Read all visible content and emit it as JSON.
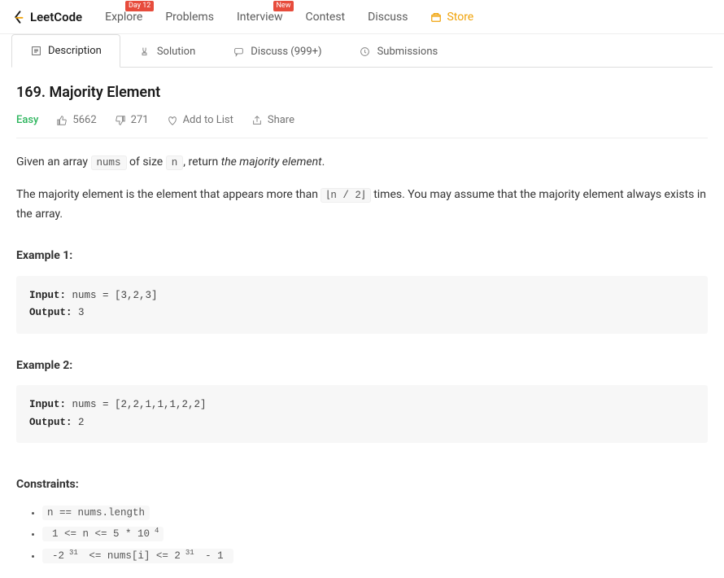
{
  "nav": {
    "logo_text": "LeetCode",
    "items": [
      {
        "label": "Explore",
        "badge": "Day 12"
      },
      {
        "label": "Problems",
        "badge": null
      },
      {
        "label": "Interview",
        "badge": "New"
      },
      {
        "label": "Contest",
        "badge": null
      },
      {
        "label": "Discuss",
        "badge": null
      },
      {
        "label": "Store",
        "badge": null,
        "store": true
      }
    ]
  },
  "tabs": {
    "description": "Description",
    "solution": "Solution",
    "discuss": "Discuss (999+)",
    "submissions": "Submissions"
  },
  "problem": {
    "title": "169. Majority Element",
    "difficulty": "Easy",
    "likes": "5662",
    "dislikes": "271",
    "add_to_list": "Add to List",
    "share": "Share",
    "para1_a": "Given an array ",
    "code_nums": "nums",
    "para1_b": " of size ",
    "code_n": "n",
    "para1_c": ", return ",
    "para1_d": "the majority element",
    "para1_e": ".",
    "para2_a": "The majority element is the element that appears more than ",
    "code_floor": "⌊n / 2⌋",
    "para2_b": " times. You may assume that the majority element always exists in the array.",
    "example1_head": "Example 1:",
    "example1_input_label": "Input:",
    "example1_input": " nums = [3,2,3]",
    "example1_output_label": "Output:",
    "example1_output": " 3",
    "example2_head": "Example 2:",
    "example2_input_label": "Input:",
    "example2_input": " nums = [2,2,1,1,1,2,2]",
    "example2_output_label": "Output:",
    "example2_output": " 2",
    "constraints_head": "Constraints:",
    "constraints": {
      "c1": "n == nums.length",
      "c2_a": "1 <= n <= 5 * 10",
      "c2_sup": "4",
      "c3_a": "-2",
      "c3_sup1": "31",
      "c3_b": " <= nums[i] <= 2",
      "c3_sup2": "31",
      "c3_c": " - 1"
    }
  }
}
